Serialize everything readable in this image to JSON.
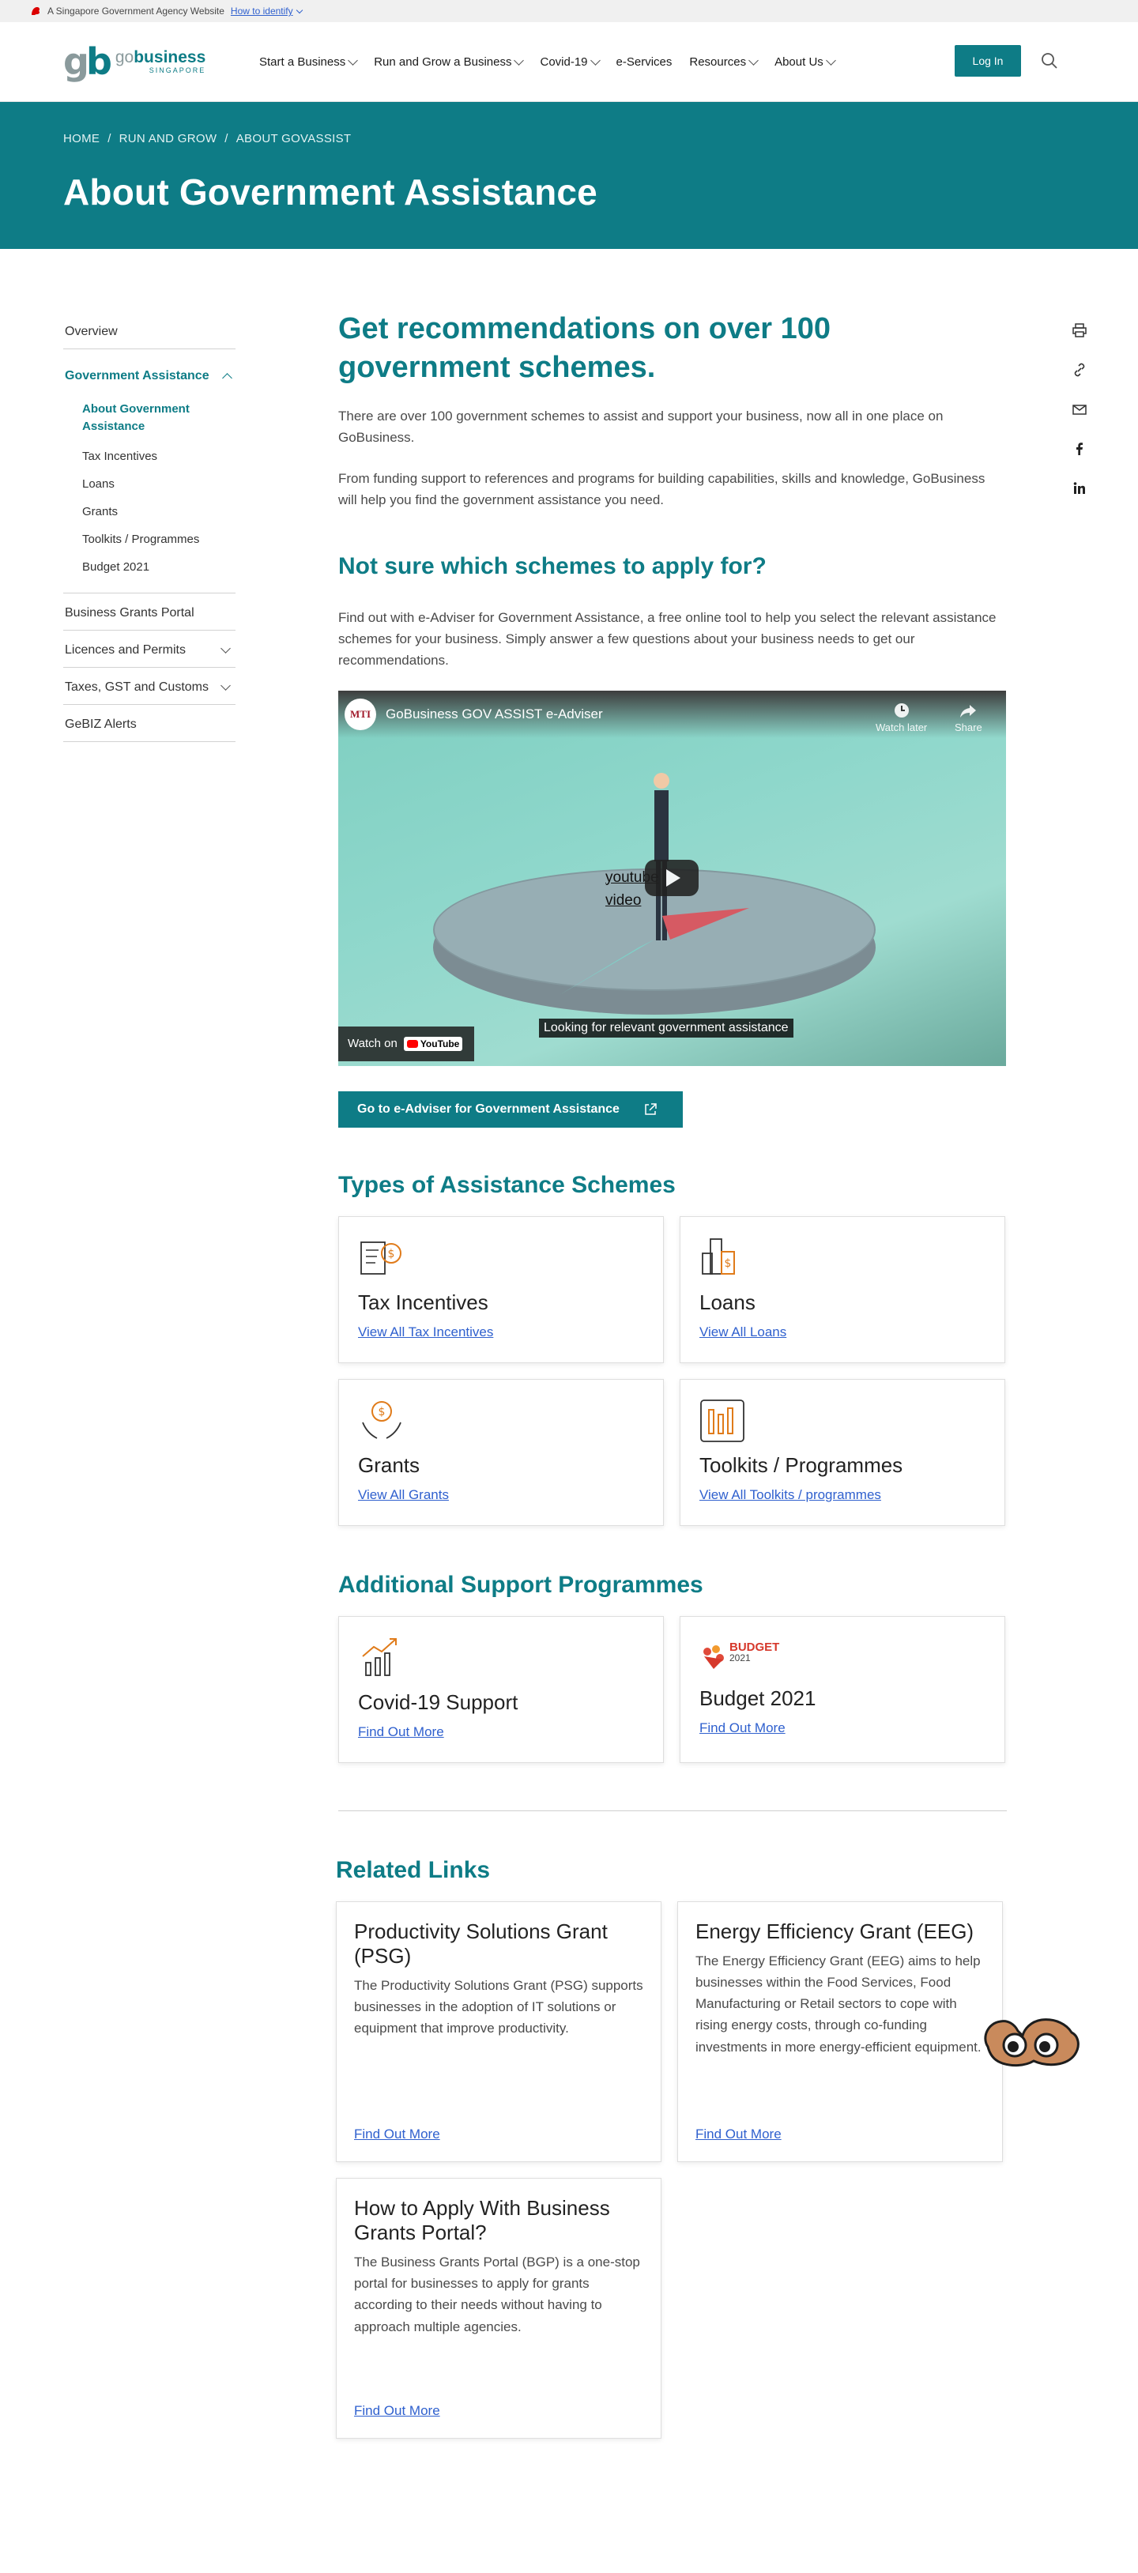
{
  "masthead": {
    "text": "A Singapore Government Agency Website",
    "identify": "How to identify"
  },
  "brand": {
    "mark": "gb",
    "name_a": "go",
    "name_b": "business",
    "sub": "SINGAPORE"
  },
  "nav": [
    {
      "label": "Start a Business"
    },
    {
      "label": "Run and Grow a Business"
    },
    {
      "label": "Covid-19"
    },
    {
      "label": "e-Services"
    },
    {
      "label": "Resources"
    },
    {
      "label": "About Us"
    }
  ],
  "header": {
    "login": "Log In"
  },
  "breadcrumb": [
    "HOME",
    "RUN AND GROW",
    "ABOUT GOVASSIST"
  ],
  "hero": {
    "title": "About Government Assistance"
  },
  "sidebar": {
    "overview": "Overview",
    "active": "Government Assistance",
    "sub": [
      "About Government Assistance",
      "Tax Incentives",
      "Loans",
      "Grants",
      "Toolkits / Programmes",
      "Budget 2021"
    ],
    "items": [
      "Business Grants Portal",
      "Licences and Permits",
      "Taxes, GST and Customs",
      "GeBIZ Alerts"
    ]
  },
  "main": {
    "heading": "Get recommendations on over 100 government schemes.",
    "p1": "There are over 100 government schemes to assist and support your business, now all in one place on GoBusiness.",
    "p2": "From funding support to references and programs for building capabilities, skills and knowledge, GoBusiness will help you find the government assistance you need.",
    "sub_heading": "Not sure which schemes to apply for?",
    "p3": "Find out with e-Adviser for Government Assistance, a free online tool to help you select the relevant assistance schemes for your business. Simply answer a few questions about your business needs to get our recommendations.",
    "video": {
      "channel": "MTI",
      "title": "GoBusiness GOV ASSIST e-Adviser",
      "watch_later": "Watch later",
      "share": "Share",
      "alt": "youtube video",
      "watch_on": "Watch on",
      "youtube": "YouTube",
      "caption": "Looking for relevant government assistance"
    },
    "cta": "Go to e-Adviser for Government Assistance"
  },
  "types": {
    "heading": "Types of Assistance Schemes",
    "cards": [
      {
        "title": "Tax Incentives",
        "link": "View All Tax Incentives",
        "icon": "tax-document-icon"
      },
      {
        "title": "Loans",
        "link": "View All Loans",
        "icon": "loan-building-icon"
      },
      {
        "title": "Grants",
        "link": "View All Grants",
        "icon": "grant-hands-icon"
      },
      {
        "title": "Toolkits / Programmes",
        "link": "View All Toolkits / programmes",
        "icon": "toolkit-icon"
      }
    ]
  },
  "additional": {
    "heading": "Additional Support Programmes",
    "cards": [
      {
        "title": "Covid-19 Support",
        "link": "Find Out More",
        "icon": "growth-chart-icon"
      },
      {
        "title": "Budget 2021",
        "link": "Find Out More",
        "icon": "budget-logo-icon",
        "logo_text": "BUDGET",
        "logo_year": "2021"
      }
    ]
  },
  "related": {
    "heading": "Related Links",
    "cards": [
      {
        "title": "Productivity Solutions Grant (PSG)",
        "desc": "The Productivity Solutions Grant (PSG) supports businesses in the adoption of IT solutions or equipment that improve productivity.",
        "link": "Find Out More"
      },
      {
        "title": "Energy Efficiency Grant (EEG)",
        "desc": "The Energy Efficiency Grant (EEG) aims to help businesses within the Food Services, Food Manufacturing or Retail sectors to cope with rising energy costs, through co-funding investments in more energy-efficient equipment.",
        "link": "Find Out More"
      },
      {
        "title": "How to Apply With Business Grants Portal?",
        "desc": "The Business Grants Portal (BGP) is a one-stop portal for businesses to apply for grants according to their needs without having to approach multiple agencies.",
        "link": "Find Out More"
      }
    ]
  },
  "colors": {
    "brand": "#0e7c86",
    "link": "#2f60ce",
    "accent": "#e07b1a"
  }
}
